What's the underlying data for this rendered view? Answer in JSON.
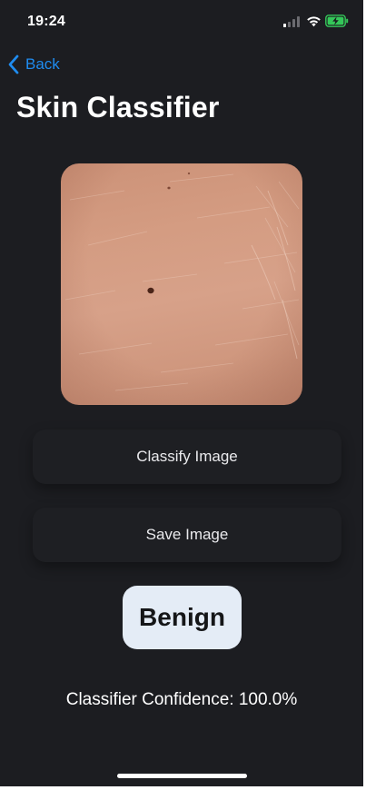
{
  "status_bar": {
    "time": "19:24",
    "icons": [
      "signal-icon",
      "wifi-icon",
      "battery-charging-icon"
    ]
  },
  "nav": {
    "back_label": "Back",
    "back_icon": "chevron-left-icon"
  },
  "title": "Skin Classifier",
  "image": {
    "subject": "skin-lesion-photo"
  },
  "buttons": {
    "classify_label": "Classify Image",
    "save_label": "Save Image"
  },
  "result": {
    "label": "Benign",
    "confidence_text": "Classifier Confidence: 100.0%"
  },
  "colors": {
    "background": "#1c1d21",
    "accent": "#1f8cf0",
    "button_bg": "#1e1f23",
    "badge_bg": "#e4ecf6"
  }
}
